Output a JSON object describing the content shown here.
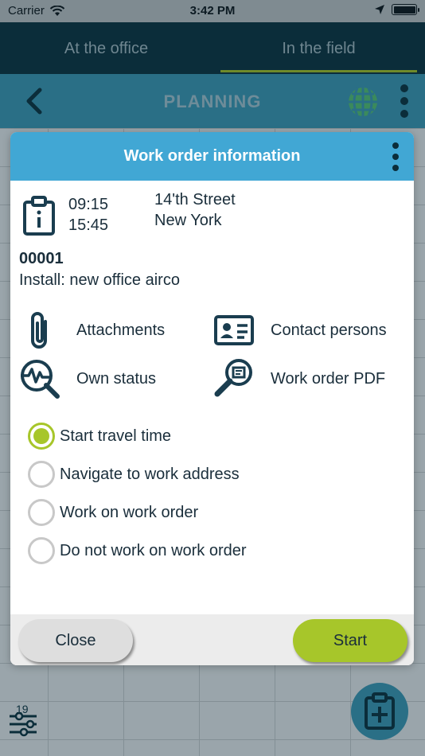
{
  "status_bar": {
    "carrier": "Carrier",
    "time": "3:42 PM"
  },
  "tabs": [
    {
      "label": "At the office",
      "active": false
    },
    {
      "label": "In the field",
      "active": true
    }
  ],
  "header": {
    "title": "PLANNING"
  },
  "dialog": {
    "title": "Work order information",
    "start_time": "09:15",
    "end_time": "15:45",
    "address_line1": "14'th Street",
    "address_line2": "New York",
    "order_number": "00001",
    "order_description": "Install: new office airco",
    "actions": {
      "attachments": "Attachments",
      "contact_persons": "Contact persons",
      "own_status": "Own status",
      "work_order_pdf": "Work order PDF"
    },
    "options": [
      {
        "label": "Start travel time",
        "selected": true
      },
      {
        "label": "Navigate to work address",
        "selected": false
      },
      {
        "label": "Work on work order",
        "selected": false
      },
      {
        "label": "Do not work on work order",
        "selected": false
      }
    ],
    "close_label": "Close",
    "start_label": "Start"
  },
  "background": {
    "filter_badge": "19"
  },
  "colors": {
    "accent_green": "#a7c62a",
    "dialog_header": "#41a7d4",
    "dark_navy": "#0b2d3a",
    "icon_color": "#1a3d4f"
  }
}
